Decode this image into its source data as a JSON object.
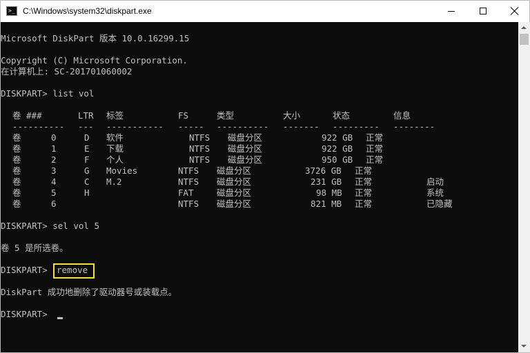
{
  "window": {
    "title": "C:\\Windows\\system32\\diskpart.exe",
    "icon": "console-app-icon",
    "controls": {
      "minimize_icon": "minimize-icon",
      "maximize_icon": "maximize-icon",
      "close_icon": "close-icon"
    }
  },
  "console": {
    "colors": {
      "background": "#0c0c0c",
      "text": "#c0c0c0",
      "highlight_border": "#f5e13a"
    },
    "header": {
      "version_line": "Microsoft DiskPart 版本 10.0.16299.15",
      "copyright_line": "Copyright (C) Microsoft Corporation.",
      "computer_line": "在计算机上: SC-201701060002"
    },
    "commands": {
      "prompt": "DISKPART>",
      "list_vol": "DISKPART> list vol",
      "sel_vol": "DISKPART> sel vol 5",
      "sel_result": "卷 5 是所选卷。",
      "remove_prompt": "DISKPART>",
      "remove_cmd": "remove",
      "remove_result": "DiskPart 成功地删除了驱动器号或装载点。",
      "final_prompt": "DISKPART>"
    },
    "volume_table": {
      "headers": {
        "vol": "卷 ###",
        "ltr": "LTR",
        "label": "标签",
        "fs": "FS",
        "type": "类型",
        "size": "大小",
        "status": "状态",
        "info": "信息"
      },
      "separators": {
        "vol": "----------",
        "ltr": "---",
        "label": "-----------",
        "fs": "-----",
        "type": "----------",
        "size": "-------",
        "status": "---------",
        "info": "--------"
      },
      "rows": [
        {
          "vol": "卷",
          "num": "0",
          "ltr": "D",
          "label": "软件",
          "fs": "NTFS",
          "type": "磁盘分区",
          "size": "922 GB",
          "status": "正常",
          "info": ""
        },
        {
          "vol": "卷",
          "num": "1",
          "ltr": "E",
          "label": "下载",
          "fs": "NTFS",
          "type": "磁盘分区",
          "size": "922 GB",
          "status": "正常",
          "info": ""
        },
        {
          "vol": "卷",
          "num": "2",
          "ltr": "F",
          "label": "个人",
          "fs": "NTFS",
          "type": "磁盘分区",
          "size": "950 GB",
          "status": "正常",
          "info": ""
        },
        {
          "vol": "卷",
          "num": "3",
          "ltr": "G",
          "label": "Movies",
          "fs": "NTFS",
          "type": "磁盘分区",
          "size": "3726 GB",
          "status": "正常",
          "info": ""
        },
        {
          "vol": "卷",
          "num": "4",
          "ltr": "C",
          "label": "M.2",
          "fs": "NTFS",
          "type": "磁盘分区",
          "size": "231 GB",
          "status": "正常",
          "info": "启动"
        },
        {
          "vol": "卷",
          "num": "5",
          "ltr": "H",
          "label": "",
          "fs": "FAT",
          "type": "磁盘分区",
          "size": "98 MB",
          "status": "正常",
          "info": "系统"
        },
        {
          "vol": "卷",
          "num": "6",
          "ltr": "",
          "label": "",
          "fs": "NTFS",
          "type": "磁盘分区",
          "size": "821 MB",
          "status": "正常",
          "info": "已隐藏"
        }
      ]
    }
  },
  "scrollbar": {
    "up_icon": "scroll-up-arrow-icon",
    "down_icon": "scroll-down-arrow-icon"
  }
}
